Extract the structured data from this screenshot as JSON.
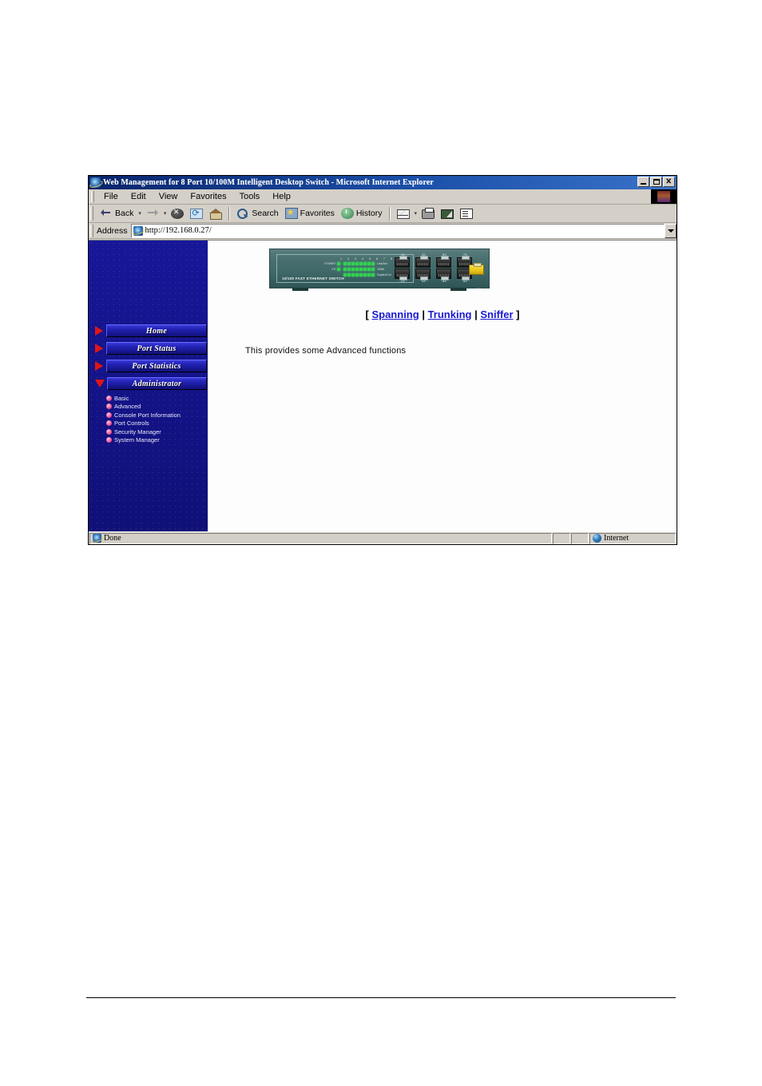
{
  "window": {
    "title": "Web Management for 8 Port 10/100M Intelligent Desktop Switch - Microsoft Internet Explorer",
    "app_icon": "ie-logo-icon",
    "buttons": {
      "minimize": "_",
      "maximize": "□",
      "close": "✕"
    }
  },
  "menubar": {
    "items": [
      {
        "label": "File"
      },
      {
        "label": "Edit"
      },
      {
        "label": "View"
      },
      {
        "label": "Favorites"
      },
      {
        "label": "Tools"
      },
      {
        "label": "Help"
      }
    ]
  },
  "toolbar": {
    "back": "Back",
    "forward": "",
    "stop": "",
    "refresh": "",
    "home": "",
    "search": "Search",
    "favorites": "Favorites",
    "history": "History",
    "mail": "",
    "print": "",
    "edit": "",
    "discuss": "",
    "caret": "▾"
  },
  "address": {
    "label": "Address",
    "url": "http://192.168.0.27/",
    "placeholder": "http://192.168.0.27/"
  },
  "sidebar": {
    "nav": [
      {
        "label": "Home",
        "state": "collapsed",
        "marker": "arrow-right-icon"
      },
      {
        "label": "Port Status",
        "state": "collapsed",
        "marker": "arrow-right-icon"
      },
      {
        "label": "Port Statistics",
        "state": "collapsed",
        "marker": "arrow-right-icon"
      },
      {
        "label": "Administrator",
        "state": "expanded",
        "marker": "arrow-down-icon"
      }
    ],
    "submenu": [
      {
        "label": "Basic"
      },
      {
        "label": "Advanced"
      },
      {
        "label": "Console Port Information"
      },
      {
        "label": "Port Controls"
      },
      {
        "label": "Security Manager"
      },
      {
        "label": "System Manager"
      }
    ],
    "bg_color": "#151590",
    "nav_text_color": "#ffffff",
    "marker_color": "#e01515",
    "bullet_color": "#f070a8"
  },
  "device": {
    "model_text": "10/100 FAST ETHERNET SWITCH",
    "port_numbers": [
      "1",
      "2",
      "3",
      "4",
      "5",
      "6",
      "7",
      "8"
    ],
    "led_rows": [
      {
        "left": "POWER",
        "right": "Link/Act"
      },
      {
        "left": "CS",
        "right": "100M"
      },
      {
        "left": "",
        "right": "Duplex/Col"
      }
    ],
    "port_labels_top": [
      "1X",
      "3X",
      "5X",
      "7X"
    ],
    "port_labels_bottom": [
      "2X",
      "4X",
      "6X",
      "8X"
    ],
    "uplink_label": "8X",
    "chassis_color": "#3f6868",
    "led_color": "#2fd44f",
    "uplink_color": "#e8c418"
  },
  "main": {
    "links_open_bracket": "[",
    "links_close_bracket": "]",
    "links": [
      {
        "label": "Spanning"
      },
      {
        "label": "Trunking"
      },
      {
        "label": "Sniffer"
      }
    ],
    "link_separator": "|",
    "body_text": "This provides some Advanced functions",
    "link_color": "#1a1ad0"
  },
  "statusbar": {
    "message": "Done",
    "zone": "Internet",
    "zone_icon": "globe-icon"
  }
}
